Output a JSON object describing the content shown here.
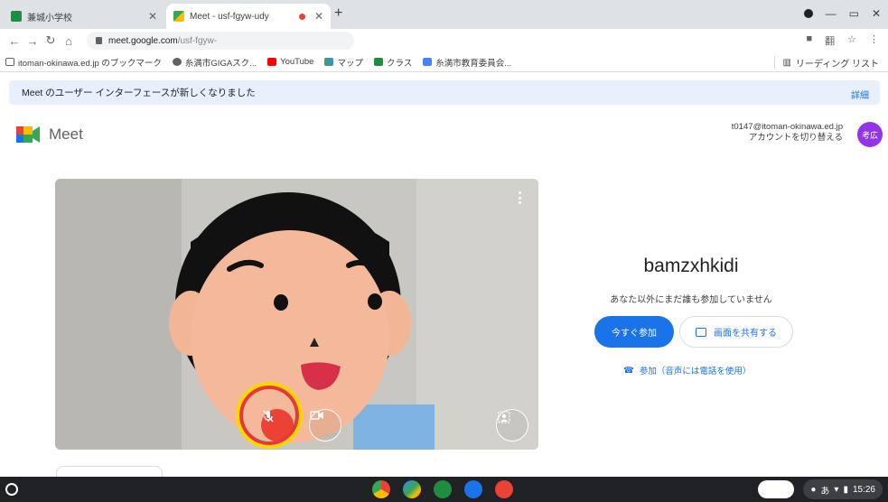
{
  "browser": {
    "tabs": [
      {
        "title": "兼城小学校",
        "active": false
      },
      {
        "title": "Meet - usf-fgyw-udy",
        "active": true,
        "recording": true
      }
    ],
    "address": {
      "host": "meet.google.com",
      "path": "/usf-fgyw-"
    },
    "bookmarks": [
      {
        "label": "itoman-okinawa.ed.jp のブックマーク",
        "icon": "folder-icon"
      },
      {
        "label": "糸満市GIGAスク...",
        "icon": "globe-icon"
      },
      {
        "label": "YouTube",
        "icon": "youtube-icon"
      },
      {
        "label": "マップ",
        "icon": "maps-icon"
      },
      {
        "label": "クラス",
        "icon": "classroom-icon"
      },
      {
        "label": "糸満市教育委員会...",
        "icon": "site-icon"
      }
    ],
    "reading_list": "リーディング リスト"
  },
  "banner": {
    "message": "Meet のユーザー インターフェースが新しくなりました",
    "details": "詳細"
  },
  "meet": {
    "logo_label": "Meet",
    "account_email": "t0147@itoman-okinawa.ed.jp",
    "switch_account": "アカウントを切り替える",
    "avatar_text": "考広"
  },
  "join": {
    "meeting_code": "bamzxhkidi",
    "status": "あなた以外にまだ誰も参加していません",
    "join_now": "今すぐ参加",
    "present": "画面を共有する",
    "phone_join": "参加（音声には電話を使用）"
  },
  "shelf": {
    "time": "15:26",
    "ime": "あ"
  },
  "colors": {
    "accent": "#1a73e8",
    "mic_off": "#ea4335",
    "highlight_ring": "#ffd600"
  }
}
